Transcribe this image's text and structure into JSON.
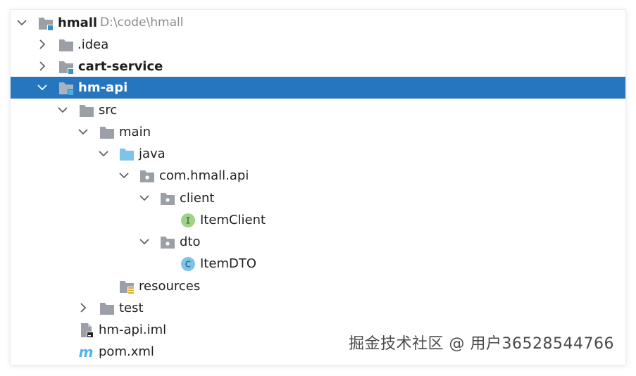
{
  "tree": {
    "nodes": [
      {
        "label": "hmall",
        "path": "D:\\code\\hmall",
        "expanded": true,
        "icon": "module-folder-icon",
        "bold": true
      },
      {
        "label": ".idea",
        "expanded": false,
        "icon": "folder-icon"
      },
      {
        "label": "cart-service",
        "expanded": false,
        "icon": "module-folder-icon",
        "bold": true
      },
      {
        "label": "hm-api",
        "expanded": true,
        "icon": "module-folder-icon",
        "bold": true,
        "selected": true
      },
      {
        "label": "src",
        "expanded": true,
        "icon": "folder-icon"
      },
      {
        "label": "main",
        "expanded": true,
        "icon": "folder-icon"
      },
      {
        "label": "java",
        "expanded": true,
        "icon": "source-folder-icon"
      },
      {
        "label": "com.hmall.api",
        "expanded": true,
        "icon": "package-icon"
      },
      {
        "label": "client",
        "expanded": true,
        "icon": "package-icon"
      },
      {
        "label": "ItemClient",
        "icon": "interface-icon",
        "badge": "I"
      },
      {
        "label": "dto",
        "expanded": true,
        "icon": "package-icon"
      },
      {
        "label": "ItemDTO",
        "icon": "class-icon",
        "badge": "C"
      },
      {
        "label": "resources",
        "icon": "resources-folder-icon"
      },
      {
        "label": "test",
        "expanded": false,
        "icon": "folder-icon"
      },
      {
        "label": "hm-api.iml",
        "icon": "iml-file-icon"
      },
      {
        "label": "pom.xml",
        "icon": "maven-icon",
        "glyph": "m"
      }
    ]
  },
  "watermark": "掘金技术社区 @ 用户36528544766",
  "colors": {
    "selection": "#2675bf",
    "folder": "#9aa0a6",
    "source_folder": "#7ec3ea",
    "module_badge": "#3592c4",
    "interface": "#9fd28a",
    "class": "#7ec3ea"
  }
}
